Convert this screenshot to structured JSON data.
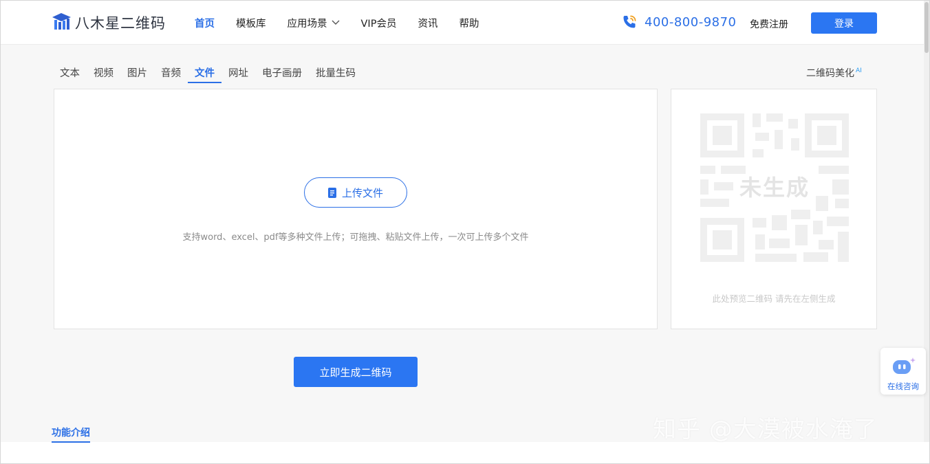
{
  "brand": {
    "name": "八木星二维码"
  },
  "nav": {
    "items": [
      {
        "label": "首页",
        "active": true
      },
      {
        "label": "模板库",
        "active": false
      },
      {
        "label": "应用场景",
        "active": false,
        "has_dropdown": true
      },
      {
        "label": "VIP会员",
        "active": false
      },
      {
        "label": "资讯",
        "active": false
      },
      {
        "label": "帮助",
        "active": false
      }
    ]
  },
  "header": {
    "phone": "400-800-9870",
    "register_label": "免费注册",
    "login_label": "登录"
  },
  "tabs": [
    {
      "label": "文本",
      "active": false
    },
    {
      "label": "视频",
      "active": false
    },
    {
      "label": "图片",
      "active": false
    },
    {
      "label": "音频",
      "active": false
    },
    {
      "label": "文件",
      "active": true
    },
    {
      "label": "网址",
      "active": false
    },
    {
      "label": "电子画册",
      "active": false
    },
    {
      "label": "批量生码",
      "active": false
    }
  ],
  "beautify": {
    "label": "二维码美化",
    "badge": "AI"
  },
  "upload": {
    "button_label": "上传文件",
    "hint": "支持word、excel、pdf等多种文件上传；可拖拽、粘贴文件上传，一次可上传多个文件"
  },
  "preview": {
    "qr_label": "未生成",
    "hint": "此处预览二维码 请先在左侧生成"
  },
  "generate_label": "立即生成二维码",
  "feature_intro_label": "功能介绍",
  "consult_label": "在线咨询",
  "watermark": "知乎 @大漠被水淹了",
  "colors": {
    "accent": "#2b6fe6",
    "button": "#2b76f2",
    "background": "#f7f7f7"
  },
  "icons": {
    "logo": "hat-logo-icon",
    "phone": "phone-icon",
    "dropdown": "chevron-down-icon",
    "upload": "document-icon",
    "consult": "chat-bot-icon"
  }
}
